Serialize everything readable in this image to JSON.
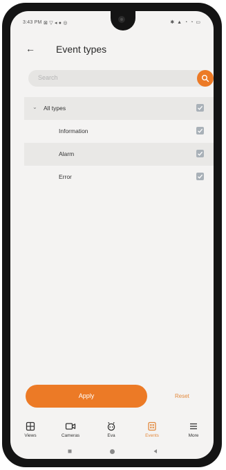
{
  "status_bar": {
    "time": "3:43 PM",
    "left_icons": "⊠ ▽ ◂ ● ◎",
    "right_icons": "✱ ▲ ◔ ◔ ▭"
  },
  "header": {
    "title": "Event types",
    "back_icon": "arrow-left-icon"
  },
  "search": {
    "placeholder": "Search"
  },
  "event_types": [
    {
      "label": "All types",
      "checked": true
    },
    {
      "label": "Information",
      "checked": true
    },
    {
      "label": "Alarm",
      "checked": true
    },
    {
      "label": "Error",
      "checked": true
    }
  ],
  "actions": {
    "apply_label": "Apply",
    "reset_label": "Reset"
  },
  "bottom_nav": [
    {
      "label": "Views",
      "icon": "grid-icon"
    },
    {
      "label": "Cameras",
      "icon": "camera-icon"
    },
    {
      "label": "Eva",
      "icon": "robot-icon"
    },
    {
      "label": "Events",
      "icon": "events-icon",
      "active": true
    },
    {
      "label": "More",
      "icon": "menu-icon"
    }
  ],
  "colors": {
    "accent": "#ec7a26",
    "checkbox": "#a9b1b8",
    "background": "#f4f3f2"
  }
}
